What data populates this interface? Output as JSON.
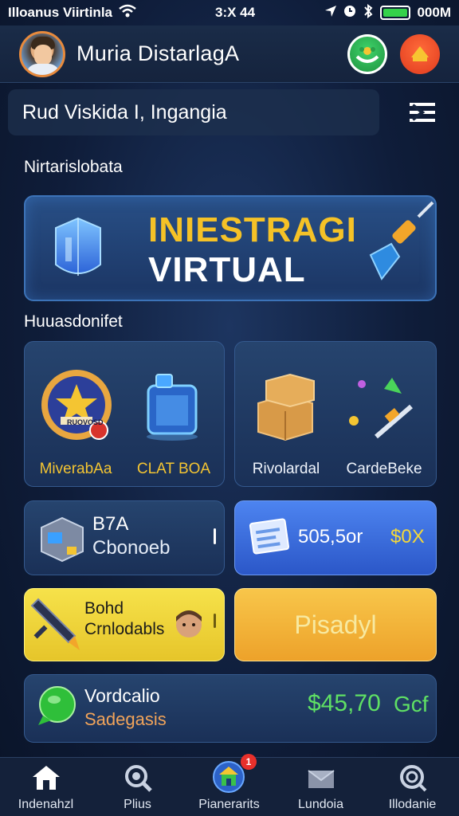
{
  "status_bar": {
    "carrier": "Illoanus Viirtinla",
    "time": "3:X 44",
    "battery_text": "000M"
  },
  "header": {
    "user_name": "Muria DistarlagA"
  },
  "location": {
    "text": "Rud Viskida I, Ingangia"
  },
  "sections": {
    "top_title": "Nirtarislobata",
    "middle_title": "Huuasdonifet"
  },
  "banner": {
    "line1": "INIESTRAGI",
    "line2": "VIRTUAL"
  },
  "tiles_left": {
    "item1_label": "MiverabAa",
    "item2_label": "CLAT BOA",
    "badge_text": "RUOVOSD"
  },
  "tiles_right": {
    "item1_label": "Rivolardal",
    "item2_label": "CardeBeke"
  },
  "stat_card_left": {
    "line1": "B7A",
    "line2": "Cbonoeb"
  },
  "stat_card_right": {
    "amount": "505,5or",
    "suffix": "$0X"
  },
  "promo_card": {
    "line1": "Bohd",
    "line2": "Crnlodabls"
  },
  "action_button": {
    "label": "Pisadyl"
  },
  "balance_card": {
    "title": "Vordcalio",
    "subtitle": "Sadegasis",
    "amount": "$45,70",
    "unit": "Gcf"
  },
  "bottom_nav": {
    "items": [
      {
        "label": "Indenahzl"
      },
      {
        "label": "Plius"
      },
      {
        "label": "Pianerarits",
        "badge": "1"
      },
      {
        "label": "Lundoia"
      },
      {
        "label": "Illodanie"
      }
    ]
  },
  "colors": {
    "accent_yellow": "#f4c532",
    "accent_green": "#3fd46a",
    "card_blue": "#26446e",
    "bright_blue": "#3d6fd6",
    "promo_yellow": "#f2d83a",
    "action_orange": "#f2b23a"
  }
}
